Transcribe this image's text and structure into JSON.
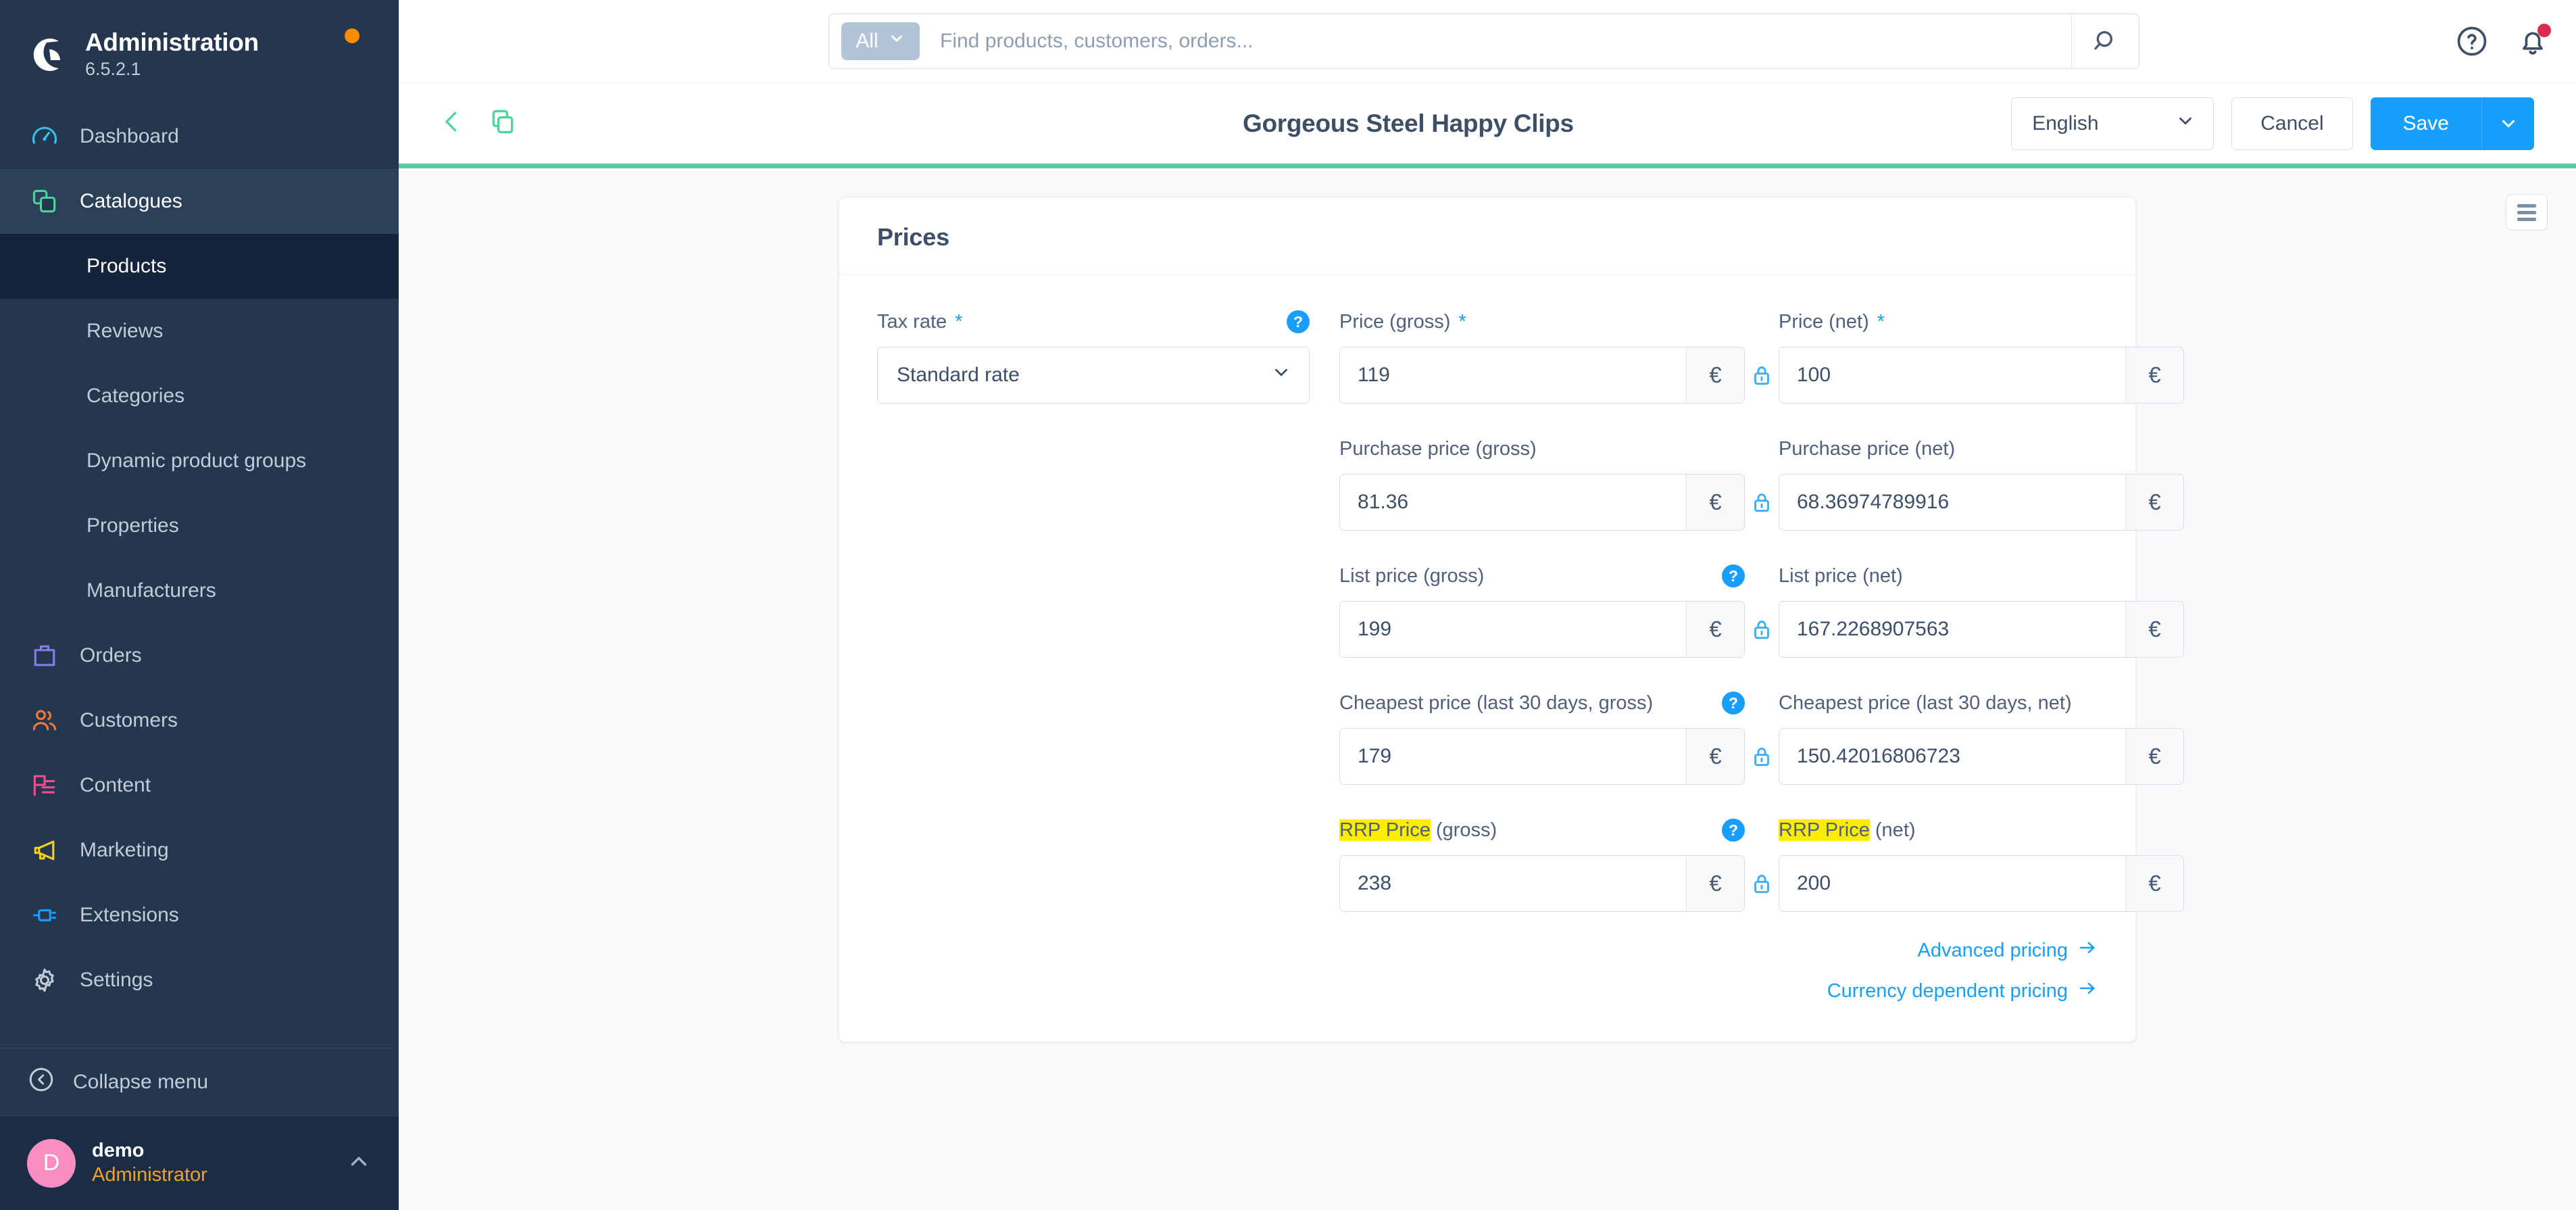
{
  "sidebar": {
    "brand": {
      "title": "Administration",
      "version": "6.5.2.1"
    },
    "items": [
      {
        "label": "Dashboard",
        "icon": "gauge-icon",
        "color": "#37c1f0"
      },
      {
        "label": "Catalogues",
        "icon": "catalogue-icon",
        "color": "#4dd599"
      },
      {
        "label": "Orders",
        "icon": "bag-icon",
        "color": "#8a7af0"
      },
      {
        "label": "Customers",
        "icon": "users-icon",
        "color": "#f0783c"
      },
      {
        "label": "Content",
        "icon": "content-icon",
        "color": "#ef4f8d"
      },
      {
        "label": "Marketing",
        "icon": "megaphone-icon",
        "color": "#f7d117"
      },
      {
        "label": "Extensions",
        "icon": "plug-icon",
        "color": "#189eff"
      },
      {
        "label": "Settings",
        "icon": "gear-icon",
        "color": "#c3cbd6"
      }
    ],
    "catalogue_children": [
      {
        "label": "Products",
        "current": true
      },
      {
        "label": "Reviews",
        "current": false
      },
      {
        "label": "Categories",
        "current": false
      },
      {
        "label": "Dynamic product groups",
        "current": false
      },
      {
        "label": "Properties",
        "current": false
      },
      {
        "label": "Manufacturers",
        "current": false
      }
    ],
    "collapse_label": "Collapse menu",
    "user": {
      "initial": "D",
      "name": "demo",
      "role": "Administrator"
    }
  },
  "topbar": {
    "scope_label": "All",
    "search_placeholder": "Find products, customers, orders...",
    "search_value": ""
  },
  "pageheader": {
    "title": "Gorgeous Steel Happy Clips",
    "language": "English",
    "cancel_label": "Cancel",
    "save_label": "Save"
  },
  "card": {
    "title": "Prices",
    "tax": {
      "label": "Tax rate",
      "required": "*",
      "value": "Standard rate"
    },
    "rows": [
      {
        "left": {
          "label": "Price (gross)",
          "required": "*",
          "value": "119",
          "suffix": "€"
        },
        "right": {
          "label": "Price (net)",
          "required": "*",
          "value": "100",
          "suffix": "€"
        },
        "help": false,
        "highlight": false
      },
      {
        "left": {
          "label": "Purchase price (gross)",
          "required": "",
          "value": "81.36",
          "suffix": "€"
        },
        "right": {
          "label": "Purchase price (net)",
          "required": "",
          "value": "68.36974789916",
          "suffix": "€"
        },
        "help": false,
        "highlight": false
      },
      {
        "left": {
          "label": "List price (gross)",
          "required": "",
          "value": "199",
          "suffix": "€"
        },
        "right": {
          "label": "List price (net)",
          "required": "",
          "value": "167.2268907563",
          "suffix": "€"
        },
        "help": true,
        "highlight": false
      },
      {
        "left": {
          "label": "Cheapest price (last 30 days, gross)",
          "required": "",
          "value": "179",
          "suffix": "€"
        },
        "right": {
          "label": "Cheapest price (last 30 days, net)",
          "required": "",
          "value": "150.42016806723",
          "suffix": "€"
        },
        "help": true,
        "highlight": false
      },
      {
        "left": {
          "label": "RRP Price",
          "label_suffix": " (gross)",
          "required": "",
          "value": "238",
          "suffix": "€"
        },
        "right": {
          "label": "RRP Price",
          "label_suffix": " (net)",
          "required": "",
          "value": "200",
          "suffix": "€"
        },
        "help": true,
        "highlight": true
      }
    ],
    "links": [
      {
        "label": "Advanced pricing"
      },
      {
        "label": "Currency dependent pricing"
      }
    ]
  },
  "colors": {
    "sidebar_bg": "#24374e",
    "accent_blue": "#189eff",
    "green_rule": "#5ccba0",
    "highlight_yellow": "#ffed00",
    "notification_red": "#de294c"
  }
}
